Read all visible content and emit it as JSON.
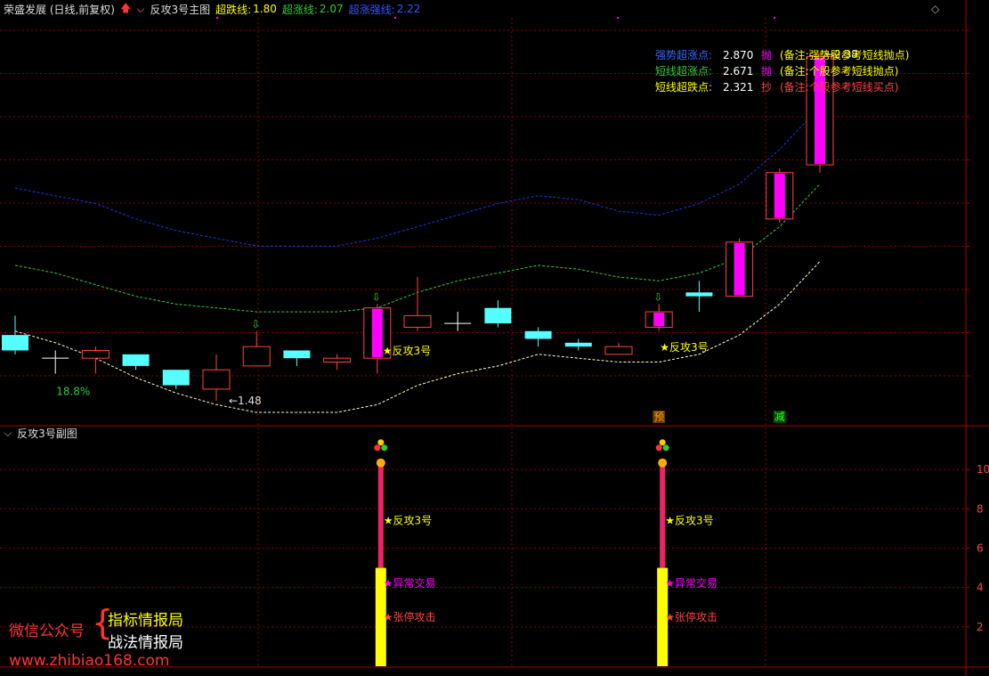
{
  "header": {
    "stock_title": "荣盛发展 (日线,前复权)",
    "indicator_name": "反攻3号主图",
    "lines": [
      {
        "label": "超跌线:",
        "value": "1.80",
        "color": "#ffff00"
      },
      {
        "label": "超涨线:",
        "value": "2.07",
        "color": "#33cc33"
      },
      {
        "label": "超涨强线:",
        "value": "2.22",
        "color": "#3355ff"
      }
    ],
    "sub_panel_title": "反攻3号副图"
  },
  "notes": [
    {
      "label": "强势超涨点:",
      "value": "2.870",
      "action": "抛",
      "remark": "(备注:强势股参考短线抛点)",
      "color": "#3366ff"
    },
    {
      "label": "短线超涨点:",
      "value": "2.671",
      "action": "抛",
      "remark": "(备注:个股参考短线抛点)",
      "color": "#33cc33"
    },
    {
      "label": "短线超跌点:",
      "value": "2.321",
      "action": "抄",
      "remark": "(备注:个股参考短线买点)",
      "color": "#ffff00"
    }
  ],
  "watermark": {
    "label": "微信公众号",
    "brace": "{",
    "line1": "指标情报局",
    "line2": "战法情报局",
    "url": "www.zhibiao168.com"
  },
  "colors": {
    "up": "#ff4444",
    "down": "#55ffff",
    "magenta": "#ff00ff",
    "yellow": "#ffff00",
    "green": "#33cc33",
    "blue": "#2233dd",
    "grid": "#8b0000"
  },
  "chart_data": {
    "type": "candlestick",
    "y_range_main": [
      1.42,
      2.47
    ],
    "y_range_sub": [
      0,
      11.5
    ],
    "sub_ticks": [
      "2",
      "4",
      "6",
      "8",
      "10"
    ],
    "candles": [
      {
        "o": 1.65,
        "h": 1.7,
        "l": 1.6,
        "c": 1.61,
        "color": "cyan"
      },
      {
        "o": 1.59,
        "h": 1.61,
        "l": 1.55,
        "c": 1.59,
        "color": "white"
      },
      {
        "o": 1.59,
        "h": 1.62,
        "l": 1.55,
        "c": 1.61,
        "color": "red"
      },
      {
        "o": 1.6,
        "h": 1.6,
        "l": 1.56,
        "c": 1.57,
        "color": "cyan"
      },
      {
        "o": 1.56,
        "h": 1.56,
        "l": 1.51,
        "c": 1.52,
        "color": "cyan"
      },
      {
        "o": 1.51,
        "h": 1.6,
        "l": 1.48,
        "c": 1.56,
        "color": "red"
      },
      {
        "o": 1.57,
        "h": 1.66,
        "l": 1.57,
        "c": 1.62,
        "color": "red"
      },
      {
        "o": 1.61,
        "h": 1.61,
        "l": 1.57,
        "c": 1.59,
        "color": "cyan"
      },
      {
        "o": 1.58,
        "h": 1.6,
        "l": 1.56,
        "c": 1.59,
        "color": "red"
      },
      {
        "o": 1.59,
        "h": 1.73,
        "l": 1.55,
        "c": 1.72,
        "color": "magenta"
      },
      {
        "o": 1.67,
        "h": 1.8,
        "l": 1.66,
        "c": 1.7,
        "color": "red"
      },
      {
        "o": 1.68,
        "h": 1.71,
        "l": 1.66,
        "c": 1.68,
        "color": "white"
      },
      {
        "o": 1.72,
        "h": 1.74,
        "l": 1.67,
        "c": 1.68,
        "color": "cyan"
      },
      {
        "o": 1.66,
        "h": 1.67,
        "l": 1.62,
        "c": 1.64,
        "color": "cyan"
      },
      {
        "o": 1.63,
        "h": 1.64,
        "l": 1.61,
        "c": 1.62,
        "color": "cyan"
      },
      {
        "o": 1.6,
        "h": 1.63,
        "l": 1.6,
        "c": 1.62,
        "color": "red"
      },
      {
        "o": 1.67,
        "h": 1.73,
        "l": 1.66,
        "c": 1.71,
        "color": "magenta"
      },
      {
        "o": 1.76,
        "h": 1.79,
        "l": 1.71,
        "c": 1.75,
        "color": "cyan"
      },
      {
        "o": 1.75,
        "h": 1.9,
        "l": 1.75,
        "c": 1.89,
        "color": "magenta"
      },
      {
        "o": 1.95,
        "h": 2.08,
        "l": 1.94,
        "c": 2.07,
        "color": "magenta"
      },
      {
        "o": 2.09,
        "h": 2.38,
        "l": 2.07,
        "c": 2.37,
        "color": "magenta"
      }
    ],
    "blue_line": [
      2.03,
      2.01,
      1.99,
      1.95,
      1.92,
      1.9,
      1.88,
      1.88,
      1.88,
      1.9,
      1.93,
      1.96,
      1.99,
      2.01,
      2.0,
      1.97,
      1.96,
      1.99,
      2.04,
      2.13,
      2.24
    ],
    "green_line": [
      1.83,
      1.81,
      1.78,
      1.75,
      1.73,
      1.72,
      1.71,
      1.71,
      1.71,
      1.72,
      1.76,
      1.79,
      1.81,
      1.83,
      1.82,
      1.8,
      1.79,
      1.81,
      1.85,
      1.93,
      2.04
    ],
    "yellow_line": [
      1.66,
      1.63,
      1.59,
      1.54,
      1.5,
      1.47,
      1.45,
      1.45,
      1.45,
      1.47,
      1.52,
      1.55,
      1.57,
      1.6,
      1.59,
      1.58,
      1.58,
      1.6,
      1.65,
      1.73,
      1.84
    ],
    "annotations": {
      "pct_label": "18.8%",
      "low_label": "1.48",
      "high_label": "2.38",
      "signal_label": "反攻3号",
      "signal_label_2": "反攻3号",
      "yu_badge": "预",
      "jian_badge": "减"
    },
    "sub_signals": [
      {
        "index": 9,
        "bar_value": 10.2,
        "yellow_top": 5.0,
        "labels": [
          "★反攻3号",
          "★异常交易",
          "★张停攻击"
        ]
      },
      {
        "index": 16,
        "bar_value": 10.2,
        "yellow_top": 5.0,
        "labels": [
          "★反攻3号",
          "★异常交易",
          "★张停攻击"
        ]
      }
    ]
  }
}
